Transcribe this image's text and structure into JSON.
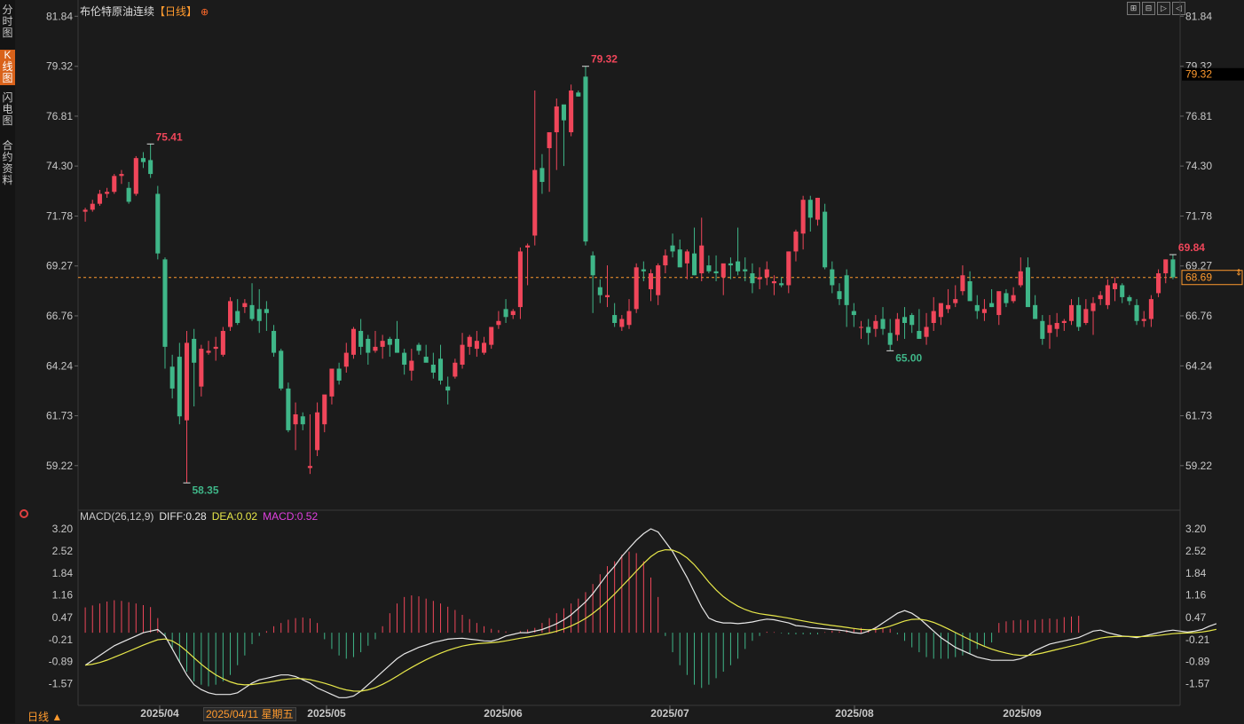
{
  "left_tabs": [
    {
      "label": "分时图",
      "active": false
    },
    {
      "label": "K线图",
      "active": true
    },
    {
      "label": "闪电图",
      "active": false
    },
    {
      "label": "合约资料",
      "active": false
    }
  ],
  "title": {
    "name": "布伦特原油连续",
    "period": "【日线】"
  },
  "toolbar": [
    "⊞",
    "⊟",
    "▷",
    "◁"
  ],
  "colors": {
    "up": "#f0465a",
    "down": "#3fb688",
    "dif": "#e8e8e8",
    "dea": "#e8e84a",
    "ref_line": "#ff9a2e",
    "grid": "#2e2e2e",
    "axis_text": "#c8c8c8"
  },
  "price_axis": {
    "ticks": [
      "81.84",
      "79.32",
      "76.81",
      "74.30",
      "71.78",
      "69.27",
      "66.76",
      "64.24",
      "61.73",
      "59.22"
    ]
  },
  "price_badges": {
    "high": "79.32",
    "current": "68.69"
  },
  "annotations": {
    "high": "79.32",
    "high2": "75.41",
    "low": "58.35",
    "low2": "65.00",
    "last": "69.84"
  },
  "macd": {
    "label": "MACD(26,12,9)",
    "diff_text": "DIFF:0.28",
    "dea_text": "DEA:0.02",
    "macd_text": "MACD:0.52",
    "ticks": [
      "3.20",
      "2.52",
      "1.84",
      "1.16",
      "0.47",
      "-0.21",
      "-0.89",
      "-1.57"
    ]
  },
  "date_labels": [
    "2025/04",
    "2025/05",
    "2025/06",
    "2025/07",
    "2025/08",
    "2025/09"
  ],
  "cursor_date": "2025/04/11 星期五",
  "period_switch": "日线 ▲",
  "chart_data": {
    "type": "candlestick",
    "title": "布伦特原油连续",
    "ylim": [
      57.2,
      82.3
    ],
    "ref_price": 68.69,
    "candles": [
      [
        72.0,
        72.2,
        71.5,
        72.1
      ],
      [
        72.1,
        72.6,
        72.0,
        72.4
      ],
      [
        72.4,
        73.1,
        72.3,
        72.9
      ],
      [
        72.9,
        73.2,
        72.7,
        73.0
      ],
      [
        73.0,
        73.9,
        72.9,
        73.8
      ],
      [
        73.8,
        74.1,
        73.4,
        73.9
      ],
      [
        73.2,
        73.5,
        72.4,
        72.5
      ],
      [
        72.9,
        74.8,
        72.8,
        74.7
      ],
      [
        74.7,
        75.0,
        74.2,
        74.5
      ],
      [
        74.6,
        75.41,
        73.7,
        73.9
      ],
      [
        72.9,
        73.3,
        69.6,
        69.9
      ],
      [
        69.6,
        69.7,
        64.1,
        65.2
      ],
      [
        64.2,
        64.8,
        62.6,
        63.1
      ],
      [
        64.7,
        65.4,
        61.3,
        61.7
      ],
      [
        61.5,
        66.0,
        58.35,
        65.4
      ],
      [
        65.6,
        66.1,
        62.2,
        64.4
      ],
      [
        63.2,
        65.3,
        62.7,
        65.1
      ],
      [
        64.9,
        65.5,
        64.8,
        65.0
      ],
      [
        65.1,
        65.7,
        64.5,
        65.2
      ],
      [
        64.8,
        66.2,
        64.7,
        66.0
      ],
      [
        66.2,
        67.7,
        66.0,
        67.5
      ],
      [
        67.0,
        67.6,
        66.3,
        66.4
      ],
      [
        67.2,
        67.6,
        66.9,
        67.4
      ],
      [
        67.3,
        68.4,
        66.5,
        66.6
      ],
      [
        67.1,
        68.1,
        65.9,
        66.5
      ],
      [
        67.1,
        67.5,
        66.0,
        66.9
      ],
      [
        66.0,
        66.3,
        64.7,
        64.9
      ],
      [
        65.0,
        65.1,
        63.0,
        63.1
      ],
      [
        63.1,
        63.4,
        60.9,
        61.0
      ],
      [
        61.3,
        62.4,
        60.0,
        61.8
      ],
      [
        61.7,
        61.9,
        61.0,
        61.3
      ],
      [
        59.1,
        61.8,
        58.8,
        59.2
      ],
      [
        60.0,
        62.4,
        59.7,
        61.9
      ],
      [
        61.3,
        62.6,
        60.9,
        62.8
      ],
      [
        62.7,
        63.6,
        62.3,
        64.1
      ],
      [
        64.1,
        64.4,
        63.3,
        63.5
      ],
      [
        64.2,
        65.4,
        63.9,
        64.9
      ],
      [
        64.8,
        66.2,
        64.6,
        66.1
      ],
      [
        66.0,
        66.6,
        64.8,
        65.2
      ],
      [
        65.6,
        65.8,
        64.3,
        64.9
      ],
      [
        65.0,
        66.0,
        64.9,
        65.2
      ],
      [
        65.2,
        65.8,
        64.6,
        65.5
      ],
      [
        65.6,
        65.7,
        64.7,
        65.3
      ],
      [
        65.6,
        66.5,
        64.9,
        64.9
      ],
      [
        64.9,
        65.1,
        63.8,
        64.3
      ],
      [
        64.0,
        65.1,
        63.5,
        64.5
      ],
      [
        65.3,
        65.4,
        64.8,
        65.0
      ],
      [
        64.7,
        65.3,
        64.6,
        64.4
      ],
      [
        64.3,
        64.9,
        63.6,
        63.9
      ],
      [
        64.6,
        65.3,
        63.3,
        63.5
      ],
      [
        63.2,
        63.7,
        62.3,
        63.0
      ],
      [
        63.7,
        64.6,
        63.6,
        64.4
      ],
      [
        64.3,
        65.9,
        64.1,
        65.3
      ],
      [
        65.2,
        65.8,
        64.8,
        65.7
      ],
      [
        65.1,
        66.0,
        64.7,
        65.5
      ],
      [
        64.9,
        65.7,
        64.8,
        65.4
      ],
      [
        65.3,
        66.2,
        65.1,
        66.2
      ],
      [
        66.3,
        67.0,
        66.1,
        66.5
      ],
      [
        67.1,
        67.6,
        66.4,
        66.7
      ],
      [
        66.8,
        67.1,
        66.6,
        67.0
      ],
      [
        67.2,
        70.2,
        66.6,
        70.0
      ],
      [
        70.2,
        70.4,
        68.3,
        70.3
      ],
      [
        70.8,
        78.1,
        70.3,
        74.1
      ],
      [
        74.2,
        74.9,
        72.9,
        73.5
      ],
      [
        75.2,
        75.9,
        73.0,
        76.0
      ],
      [
        76.0,
        77.7,
        74.1,
        77.3
      ],
      [
        77.4,
        76.8,
        74.3,
        76.6
      ],
      [
        76.0,
        78.4,
        75.8,
        78.1
      ],
      [
        78.0,
        78.1,
        77.8,
        77.8
      ],
      [
        78.8,
        79.32,
        70.3,
        70.5
      ],
      [
        69.8,
        70.0,
        66.9,
        68.8
      ],
      [
        68.2,
        68.6,
        67.4,
        67.8
      ],
      [
        67.7,
        69.3,
        67.2,
        67.8
      ],
      [
        66.8,
        67.4,
        66.2,
        66.4
      ],
      [
        66.2,
        66.8,
        66.0,
        66.6
      ],
      [
        66.3,
        67.6,
        66.1,
        67.0
      ],
      [
        67.1,
        69.4,
        66.9,
        69.2
      ],
      [
        69.1,
        69.5,
        68.5,
        69.0
      ],
      [
        68.1,
        69.1,
        67.5,
        68.9
      ],
      [
        67.8,
        69.4,
        67.3,
        69.3
      ],
      [
        69.3,
        70.1,
        68.9,
        69.8
      ],
      [
        70.3,
        70.9,
        69.7,
        70.0
      ],
      [
        70.1,
        70.6,
        69.6,
        69.2
      ],
      [
        69.4,
        70.1,
        68.6,
        70.0
      ],
      [
        69.9,
        71.2,
        68.8,
        68.8
      ],
      [
        68.9,
        71.7,
        68.5,
        70.3
      ],
      [
        69.3,
        69.8,
        68.9,
        69.0
      ],
      [
        69.0,
        69.8,
        68.5,
        68.9
      ],
      [
        68.7,
        69.3,
        67.8,
        69.4
      ],
      [
        69.4,
        69.7,
        68.6,
        69.3
      ],
      [
        69.5,
        71.2,
        68.8,
        69.0
      ],
      [
        69.1,
        69.7,
        68.5,
        69.0
      ],
      [
        68.9,
        69.4,
        67.9,
        68.4
      ],
      [
        68.6,
        69.2,
        68.1,
        68.7
      ],
      [
        68.7,
        69.5,
        68.3,
        69.1
      ],
      [
        68.4,
        68.8,
        67.8,
        68.5
      ],
      [
        68.4,
        68.7,
        68.2,
        68.3
      ],
      [
        68.3,
        70.0,
        67.9,
        70.0
      ],
      [
        70.0,
        71.1,
        69.5,
        71.0
      ],
      [
        70.9,
        72.8,
        70.1,
        72.6
      ],
      [
        72.6,
        72.8,
        71.0,
        71.7
      ],
      [
        71.6,
        72.7,
        71.3,
        72.7
      ],
      [
        72.0,
        72.4,
        69.1,
        69.2
      ],
      [
        69.1,
        69.5,
        67.9,
        68.3
      ],
      [
        68.0,
        68.4,
        67.3,
        67.6
      ],
      [
        68.8,
        69.1,
        66.2,
        67.3
      ],
      [
        67.0,
        67.4,
        66.2,
        66.8
      ],
      [
        66.2,
        66.5,
        65.6,
        66.2
      ],
      [
        66.2,
        66.6,
        65.3,
        65.9
      ],
      [
        66.1,
        66.8,
        65.7,
        66.5
      ],
      [
        66.6,
        67.2,
        65.8,
        66.1
      ],
      [
        65.9,
        66.6,
        65.0,
        65.3
      ],
      [
        65.8,
        66.9,
        65.5,
        66.6
      ],
      [
        66.7,
        67.2,
        65.6,
        66.4
      ],
      [
        66.8,
        66.9,
        65.9,
        66.3
      ],
      [
        66.0,
        67.1,
        65.7,
        65.6
      ],
      [
        65.7,
        66.9,
        65.3,
        66.2
      ],
      [
        66.4,
        67.7,
        66.0,
        67.0
      ],
      [
        66.7,
        67.3,
        66.3,
        67.4
      ],
      [
        67.1,
        68.1,
        66.9,
        67.3
      ],
      [
        67.4,
        68.3,
        67.2,
        67.6
      ],
      [
        68.0,
        69.3,
        67.8,
        68.8
      ],
      [
        68.5,
        69.0,
        68.3,
        67.5
      ],
      [
        67.3,
        67.8,
        66.6,
        67.0
      ],
      [
        66.9,
        67.6,
        66.5,
        67.1
      ],
      [
        67.4,
        68.1,
        67.2,
        67.2
      ],
      [
        66.8,
        67.8,
        66.3,
        68.0
      ],
      [
        67.9,
        68.1,
        67.2,
        67.4
      ],
      [
        67.5,
        68.2,
        67.4,
        67.8
      ],
      [
        68.3,
        69.7,
        68.2,
        69.0
      ],
      [
        69.2,
        69.7,
        67.3,
        67.2
      ],
      [
        67.3,
        67.8,
        66.8,
        66.6
      ],
      [
        66.5,
        66.8,
        65.3,
        65.6
      ],
      [
        65.9,
        66.8,
        65.1,
        66.3
      ],
      [
        66.1,
        66.9,
        65.7,
        66.4
      ],
      [
        66.4,
        66.6,
        66.0,
        66.5
      ],
      [
        66.5,
        67.6,
        66.3,
        67.3
      ],
      [
        67.3,
        67.7,
        66.0,
        66.2
      ],
      [
        66.4,
        67.6,
        66.3,
        67.1
      ],
      [
        67.0,
        67.7,
        65.8,
        67.4
      ],
      [
        67.6,
        68.0,
        67.3,
        67.8
      ],
      [
        67.3,
        68.6,
        67.1,
        68.3
      ],
      [
        68.1,
        68.7,
        67.5,
        68.4
      ],
      [
        68.3,
        68.4,
        67.4,
        67.7
      ],
      [
        67.7,
        67.8,
        67.3,
        67.5
      ],
      [
        67.3,
        67.6,
        66.3,
        66.5
      ],
      [
        66.5,
        67.0,
        66.2,
        66.6
      ],
      [
        66.6,
        67.8,
        66.2,
        67.6
      ],
      [
        67.9,
        69.1,
        67.7,
        68.9
      ],
      [
        68.9,
        69.6,
        68.4,
        69.6
      ],
      [
        69.6,
        69.84,
        68.6,
        68.7
      ]
    ],
    "macd_ylim": [
      -2.1,
      3.5
    ],
    "macd_hist": [
      0.78,
      0.84,
      0.9,
      0.96,
      1.0,
      0.98,
      0.94,
      0.9,
      0.85,
      0.79,
      0.45,
      -0.1,
      -0.5,
      -0.9,
      -1.2,
      -1.5,
      -1.6,
      -1.65,
      -1.6,
      -1.5,
      -1.3,
      -1.0,
      -0.7,
      -0.35,
      -0.1,
      0.05,
      0.2,
      0.3,
      0.4,
      0.45,
      0.47,
      0.44,
      0.3,
      -0.2,
      -0.5,
      -0.7,
      -0.8,
      -0.75,
      -0.6,
      -0.4,
      -0.2,
      0.2,
      0.6,
      0.9,
      1.1,
      1.15,
      1.12,
      1.05,
      0.98,
      0.9,
      0.8,
      0.7,
      0.55,
      0.42,
      0.3,
      0.2,
      0.12,
      0.08,
      0.04,
      0.0,
      0.05,
      0.1,
      0.15,
      0.3,
      0.45,
      0.6,
      0.75,
      0.9,
      1.05,
      1.25,
      1.5,
      1.8,
      2.05,
      2.2,
      2.4,
      2.5,
      2.45,
      2.2,
      1.7,
      1.1,
      -0.1,
      -0.6,
      -1.0,
      -1.3,
      -1.6,
      -1.7,
      -1.6,
      -1.4,
      -1.2,
      -1.0,
      -0.8,
      -0.5,
      -0.25,
      -0.1,
      0.03,
      0.02,
      -0.02,
      -0.05,
      -0.05,
      -0.05,
      -0.05,
      -0.05,
      0.02,
      0.06,
      0.04,
      0.08,
      0.12,
      0.15,
      0.1,
      0.18,
      0.14,
      0.12,
      -0.05,
      -0.25,
      -0.45,
      -0.6,
      -0.75,
      -0.8,
      -0.8,
      -0.8,
      -0.75,
      -0.7,
      -0.65,
      -0.5,
      -0.4,
      -0.3,
      0.3,
      0.35,
      0.38,
      0.4,
      0.38,
      0.4,
      0.42,
      0.44,
      0.42,
      0.48,
      0.5,
      0.52
    ],
    "dif": [
      -1.0,
      -0.85,
      -0.7,
      -0.55,
      -0.4,
      -0.3,
      -0.2,
      -0.1,
      0.0,
      0.05,
      0.1,
      -0.1,
      -0.5,
      -0.9,
      -1.3,
      -1.6,
      -1.75,
      -1.85,
      -1.9,
      -1.9,
      -1.9,
      -1.85,
      -1.7,
      -1.55,
      -1.45,
      -1.4,
      -1.35,
      -1.3,
      -1.3,
      -1.35,
      -1.45,
      -1.55,
      -1.7,
      -1.8,
      -1.9,
      -2.0,
      -2.0,
      -1.95,
      -1.8,
      -1.6,
      -1.4,
      -1.2,
      -1.0,
      -0.8,
      -0.65,
      -0.55,
      -0.45,
      -0.38,
      -0.3,
      -0.25,
      -0.2,
      -0.18,
      -0.17,
      -0.2,
      -0.22,
      -0.25,
      -0.26,
      -0.2,
      -0.1,
      -0.05,
      0.0,
      0.0,
      0.05,
      0.1,
      0.18,
      0.28,
      0.4,
      0.55,
      0.75,
      0.95,
      1.2,
      1.5,
      1.8,
      2.05,
      2.35,
      2.6,
      2.85,
      3.05,
      3.2,
      3.1,
      2.8,
      2.5,
      2.1,
      1.7,
      1.25,
      0.8,
      0.45,
      0.35,
      0.3,
      0.3,
      0.28,
      0.3,
      0.33,
      0.38,
      0.42,
      0.4,
      0.35,
      0.3,
      0.22,
      0.2,
      0.16,
      0.14,
      0.12,
      0.1,
      0.08,
      0.05,
      0.0,
      -0.02,
      0.05,
      0.15,
      0.3,
      0.45,
      0.6,
      0.68,
      0.6,
      0.45,
      0.25,
      0.05,
      -0.15,
      -0.3,
      -0.45,
      -0.55,
      -0.65,
      -0.75,
      -0.8,
      -0.85,
      -0.85,
      -0.85,
      -0.85,
      -0.8,
      -0.7,
      -0.55,
      -0.45,
      -0.35,
      -0.3,
      -0.25,
      -0.2,
      -0.15,
      -0.05,
      0.05,
      0.08,
      0.0,
      -0.05,
      -0.1,
      -0.12,
      -0.15,
      -0.1,
      -0.05,
      0.0,
      0.05,
      0.08,
      0.05,
      0.02,
      0.05,
      0.1,
      0.2,
      0.28
    ]
  }
}
